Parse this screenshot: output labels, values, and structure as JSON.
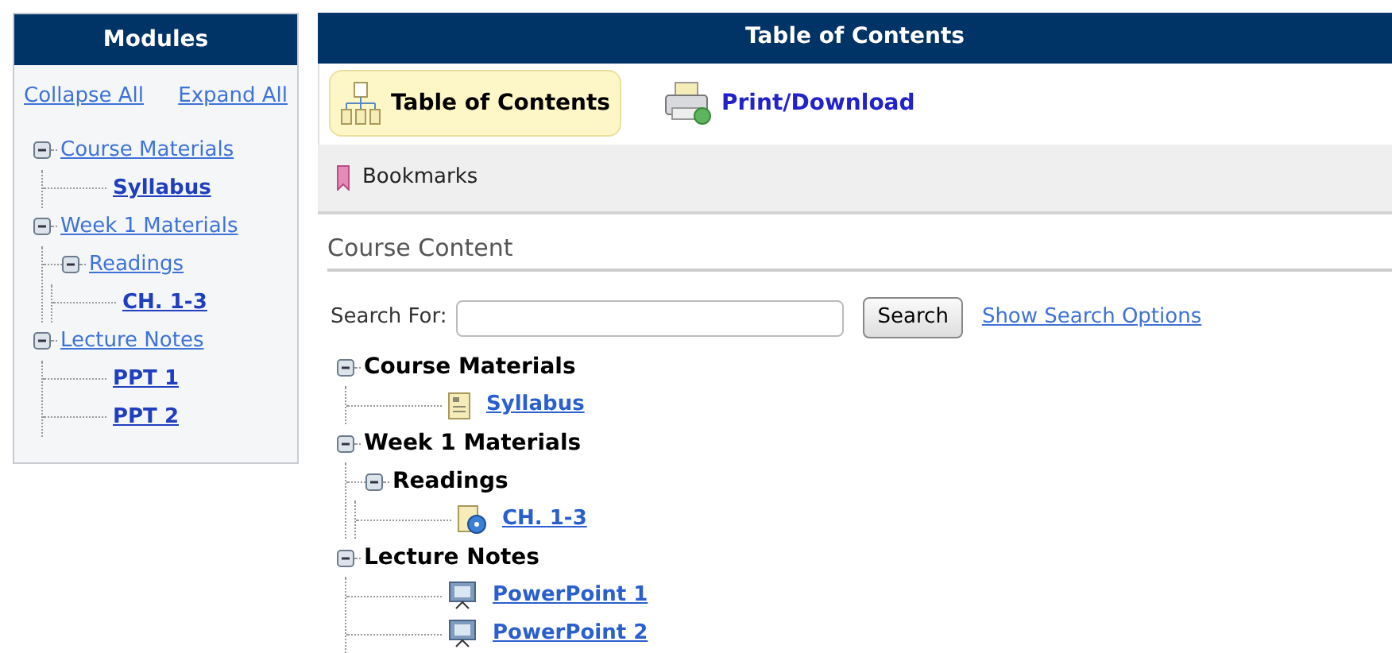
{
  "sidebar": {
    "title": "Modules",
    "actions": [
      "Collapse All",
      "Expand All"
    ],
    "tree": [
      {
        "label": "Course Materials",
        "expanded": true,
        "children": [
          {
            "label": "Syllabus"
          }
        ]
      },
      {
        "label": "Week 1 Materials",
        "expanded": true,
        "children": [
          {
            "label": "Readings",
            "expanded": true,
            "children": [
              {
                "label": "CH. 1-3"
              }
            ]
          }
        ]
      },
      {
        "label": "Lecture Notes",
        "expanded": true,
        "children": [
          {
            "label": "PPT 1"
          },
          {
            "label": "PPT 2"
          }
        ]
      }
    ]
  },
  "main": {
    "title": "Table of Contents",
    "toolbar": [
      {
        "label": "Table of Contents",
        "kind": "toc",
        "selected": true
      },
      {
        "label": "Print/Download",
        "kind": "print",
        "selected": false
      }
    ],
    "bookmarks": "Bookmarks",
    "section_title": "Course Content",
    "search": {
      "label": "Search For:",
      "button": "Search",
      "options_link": "Show Search Options"
    },
    "tree": [
      {
        "label": "Course Materials",
        "expanded": true,
        "children": [
          {
            "label": "Syllabus",
            "kind": "document"
          }
        ]
      },
      {
        "label": "Week 1 Materials",
        "expanded": true,
        "children": [
          {
            "label": "Readings",
            "expanded": true,
            "children": [
              {
                "label": "CH. 1-3",
                "kind": "media"
              }
            ]
          }
        ]
      },
      {
        "label": "Lecture Notes",
        "expanded": true,
        "children": [
          {
            "label": "PowerPoint 1",
            "kind": "slides"
          },
          {
            "label": "PowerPoint 2",
            "kind": "slides"
          }
        ]
      }
    ]
  }
}
